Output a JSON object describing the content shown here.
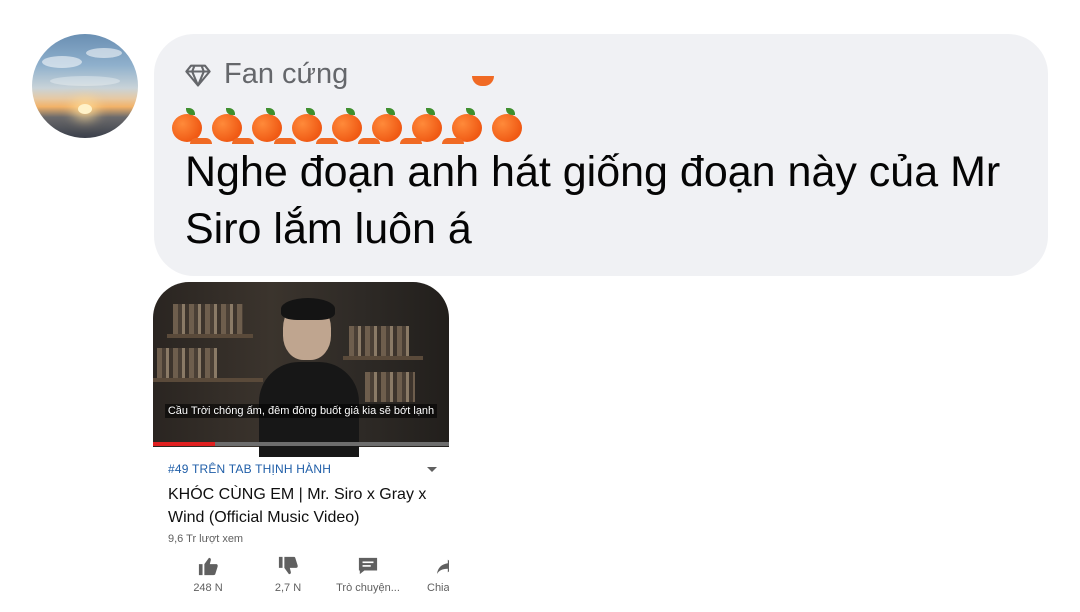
{
  "comment": {
    "author_badge": "Fan cứng",
    "text": "Nghe đoạn anh hát giống đoạn này của Mr Siro lắm luôn á",
    "badge_icon": "diamond-icon",
    "bubble_color": "#f0f1f4"
  },
  "video_card": {
    "subtitle": "Cầu Trời chóng ấm, đêm đông buốt giá kia sẽ bớt lạnh",
    "trending_label": "#49 TRÊN TAB THỊNH HÀNH",
    "title": "KHÓC CÙNG EM | Mr. Siro x Gray x Wind (Official Music Video)",
    "views": "9,6 Tr lượt xem",
    "progress_fraction": 0.21,
    "accent_color": "#e02020",
    "trending_color": "#1f5ea8",
    "actions": [
      {
        "icon": "thumbs-up-icon",
        "label": "248 N"
      },
      {
        "icon": "thumbs-down-icon",
        "label": "2,7 N"
      },
      {
        "icon": "chat-icon",
        "label": "Trò chuyện..."
      },
      {
        "icon": "share-icon",
        "label": "Chia"
      }
    ]
  }
}
